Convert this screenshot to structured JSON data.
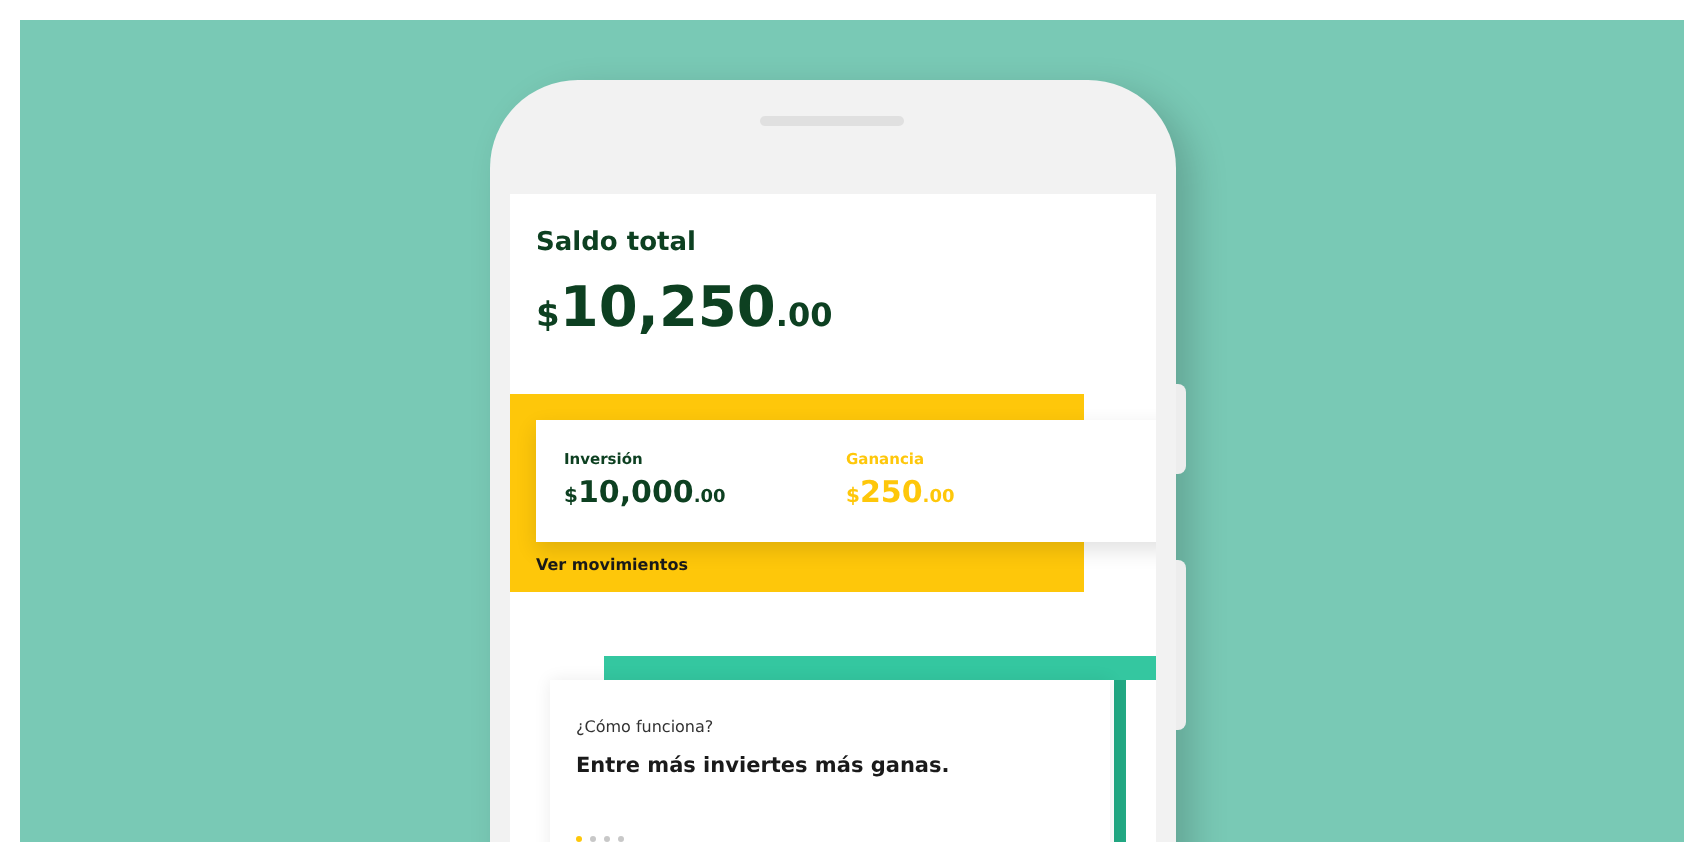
{
  "balance": {
    "title": "Saldo total",
    "currency": "$",
    "whole": "10,250",
    "cents": ".00"
  },
  "summary": [
    {
      "kind": "investment",
      "label": "Inversión",
      "currency": "$",
      "whole": "10,000",
      "cents": ".00"
    },
    {
      "kind": "gain",
      "label": "Ganancia",
      "currency": "$",
      "whole": "250",
      "cents": ".00"
    }
  ],
  "link": "Ver movimientos",
  "info_card": {
    "question": "¿Cómo funciona?",
    "headline": "Entre más inviertes más ganas."
  },
  "dots": [
    {
      "selected": true
    },
    {
      "selected": false
    },
    {
      "selected": false
    },
    {
      "selected": false
    }
  ]
}
